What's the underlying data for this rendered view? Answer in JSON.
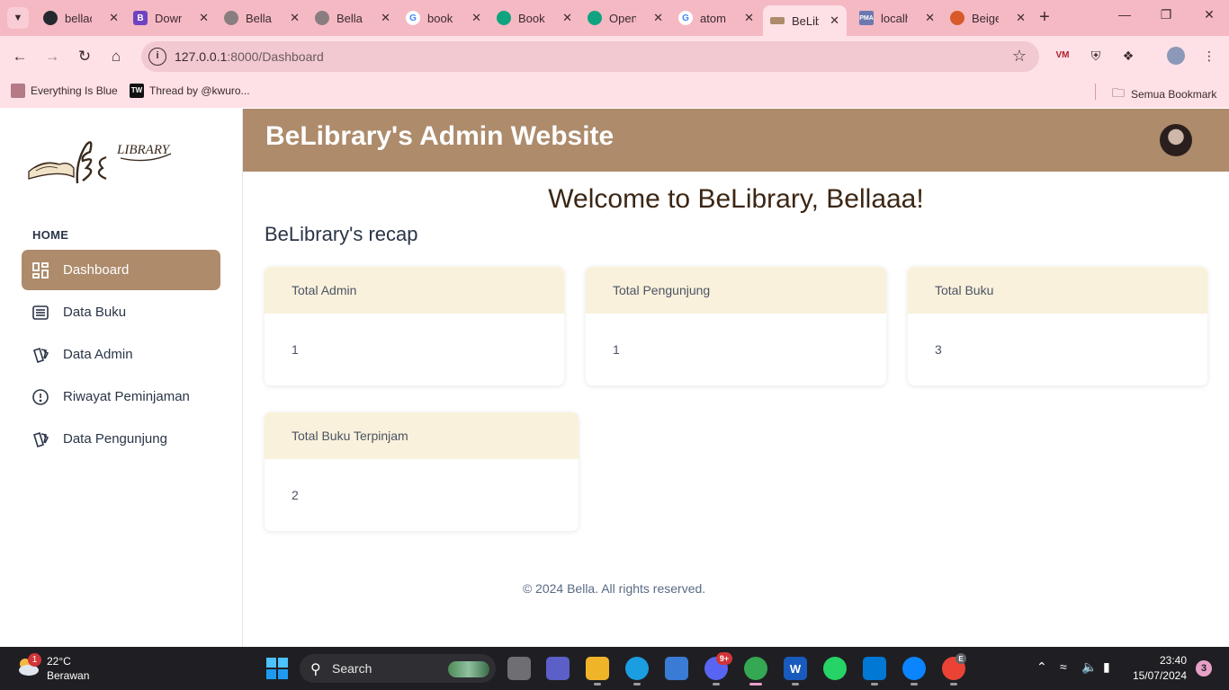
{
  "browser": {
    "tabs": [
      {
        "title": "bellac",
        "icon": "github-icon",
        "color": "#24292f"
      },
      {
        "title": "Down",
        "icon": "bootstrap-icon",
        "color": "#6f42c1"
      },
      {
        "title": "Bella",
        "icon": "globe-icon",
        "color": "#8a7d80"
      },
      {
        "title": "Bella",
        "icon": "globe-icon",
        "color": "#8a7d80"
      },
      {
        "title": "book",
        "icon": "google-icon",
        "color": "#4285f4"
      },
      {
        "title": "Book",
        "icon": "openai-icon",
        "color": "#10a37f"
      },
      {
        "title": "Open",
        "icon": "openai-icon",
        "color": "#10a37f"
      },
      {
        "title": "atom",
        "icon": "google-icon",
        "color": "#4285f4"
      },
      {
        "title": "BeLib",
        "icon": "belibrary-icon",
        "color": "#ad8b6b",
        "active": true
      },
      {
        "title": "localh",
        "icon": "pma-icon",
        "color": "#6c78af"
      },
      {
        "title": "Beige",
        "icon": "mask-icon",
        "color": "#d85a2a"
      }
    ],
    "url_host": "127.0.0.1",
    "url_path": ":8000/Dashboard",
    "bookmarks": [
      {
        "label": "Everything Is Blue"
      },
      {
        "label": "Thread by @kwuro..."
      }
    ],
    "all_bookmarks_label": "Semua Bookmark"
  },
  "sidebar": {
    "section_label": "HOME",
    "items": [
      {
        "label": "Dashboard",
        "icon": "dashboard-icon",
        "active": true
      },
      {
        "label": "Data Buku",
        "icon": "list-icon"
      },
      {
        "label": "Data Admin",
        "icon": "cards-icon"
      },
      {
        "label": "Riwayat Peminjaman",
        "icon": "alert-circle-icon"
      },
      {
        "label": "Data Pengunjung",
        "icon": "cards-icon"
      }
    ]
  },
  "header": {
    "title": "BeLibrary's Admin Website"
  },
  "main": {
    "welcome": "Welcome to BeLibrary, Bellaaa!",
    "recap_title": "BeLibrary's recap",
    "cards": [
      {
        "title": "Total Admin",
        "value": "1"
      },
      {
        "title": "Total Pengunjung",
        "value": "1"
      },
      {
        "title": "Total Buku",
        "value": "3"
      },
      {
        "title": "Total Buku Terpinjam",
        "value": "2"
      }
    ],
    "footer": "© 2024 Bella. All rights reserved."
  },
  "taskbar": {
    "weather_temp": "22°C",
    "weather_desc": "Berawan",
    "weather_badge": "1",
    "search_label": "Search",
    "discord_badge": "9+",
    "chrome_profile_badge": "E",
    "time": "23:40",
    "date": "15/07/2024",
    "notification_count": "3"
  },
  "colors": {
    "accent": "#ad8b6b",
    "card_header": "#faf1dc",
    "browser_frame": "#f5b9c4"
  }
}
